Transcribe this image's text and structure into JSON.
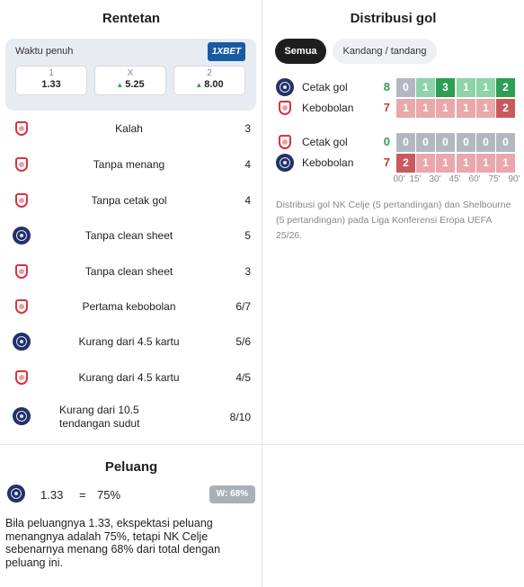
{
  "streaks": {
    "title": "Rentetan",
    "odds": {
      "label": "Waktu penuh",
      "bookmaker": "1XBET",
      "cells": [
        {
          "key": "1",
          "value": "1.33",
          "trend": ""
        },
        {
          "key": "X",
          "value": "5.25",
          "trend": "up"
        },
        {
          "key": "2",
          "value": "8.00",
          "trend": "up"
        }
      ]
    },
    "rows": [
      {
        "team": "shelbourne",
        "label": "Kalah",
        "value": "3"
      },
      {
        "team": "shelbourne",
        "label": "Tanpa menang",
        "value": "4"
      },
      {
        "team": "shelbourne",
        "label": "Tanpa cetak gol",
        "value": "4"
      },
      {
        "team": "celje",
        "label": "Tanpa clean sheet",
        "value": "5"
      },
      {
        "team": "shelbourne",
        "label": "Tanpa clean sheet",
        "value": "3"
      },
      {
        "team": "shelbourne",
        "label": "Pertama kebobolan",
        "value": "6/7"
      },
      {
        "team": "celje",
        "label": "Kurang dari 4.5 kartu",
        "value": "5/6"
      },
      {
        "team": "shelbourne",
        "label": "Kurang dari 4.5 kartu",
        "value": "4/5"
      },
      {
        "team": "celje",
        "label": "Kurang dari 10.5 tendangan sudut",
        "value": "8/10"
      }
    ]
  },
  "goal_distribution": {
    "title": "Distribusi gol",
    "tabs": [
      {
        "label": "Semua",
        "active": true
      },
      {
        "label": "Kandang / tandang",
        "active": false
      }
    ],
    "groups": [
      {
        "rows": [
          {
            "team": "celje",
            "label": "Cetak gol",
            "total": "8",
            "type": "scored",
            "cells": [
              "0",
              "1",
              "3",
              "1",
              "1",
              "2"
            ]
          },
          {
            "team": "shelbourne",
            "label": "Kebobolan",
            "total": "7",
            "type": "conceded",
            "cells": [
              "1",
              "1",
              "1",
              "1",
              "1",
              "2"
            ]
          }
        ]
      },
      {
        "rows": [
          {
            "team": "shelbourne",
            "label": "Cetak gol",
            "total": "0",
            "type": "scored",
            "cells": [
              "0",
              "0",
              "0",
              "0",
              "0",
              "0"
            ]
          },
          {
            "team": "celje",
            "label": "Kebobolan",
            "total": "7",
            "type": "conceded",
            "cells": [
              "2",
              "1",
              "1",
              "1",
              "1",
              "1"
            ]
          }
        ]
      }
    ],
    "ticks": [
      "00'",
      "15'",
      "30'",
      "45'",
      "60'",
      "75'",
      "90'"
    ],
    "note": "Distribusi gol NK Celje (5 pertandingan) dan Shelbourne (5 pertandingan) pada Liga Konferensi Eropa UEFA 25/26.",
    "colors": {
      "scored_total": "#2f9e55",
      "conceded_total": "#c23b3b",
      "scored_zero": "#b3b8c0",
      "scored_low": "#8fd3a8",
      "scored_high": "#2f9e55",
      "conceded_zero": "#b3b8c0",
      "conceded_low": "#e9a8ab",
      "conceded_high": "#c85a5e"
    }
  },
  "probability": {
    "title": "Peluang",
    "team": "celje",
    "odds": "1.33",
    "equals": "=",
    "implied": "75%",
    "win_badge": "W: 68%",
    "description": "Bila peluangnya 1.33, ekspektasi peluang menangnya adalah 75%, tetapi NK Celje sebenarnya menang 68% dari total dengan peluang ini."
  }
}
